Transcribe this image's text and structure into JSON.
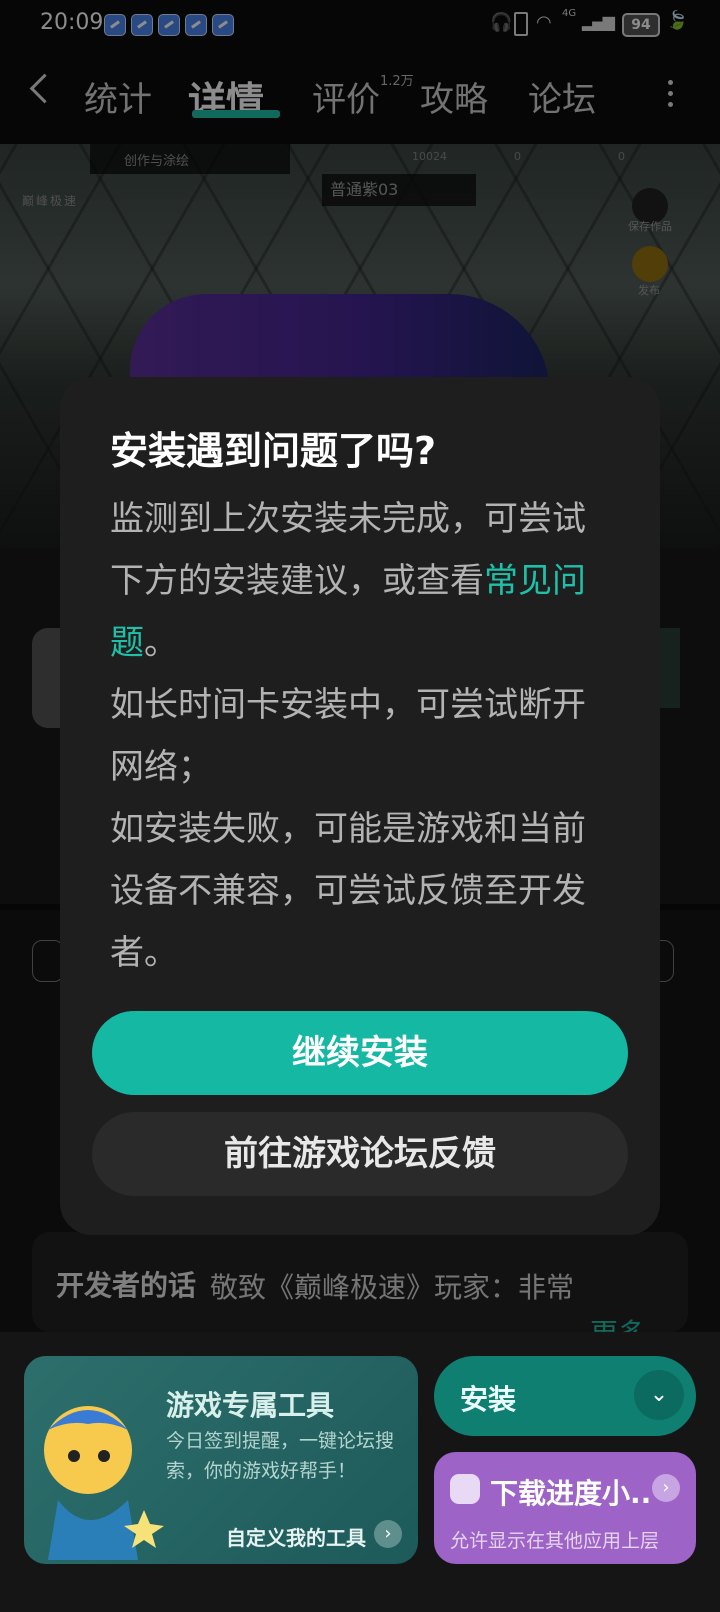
{
  "status_bar": {
    "time": "20:09",
    "network": "4G",
    "battery": "94"
  },
  "nav": {
    "tabs": [
      {
        "label": "统计"
      },
      {
        "label": "详情"
      },
      {
        "label": "评价"
      },
      {
        "label": "攻略"
      },
      {
        "label": "论坛"
      }
    ],
    "active_tab": "详情",
    "review_count_badge": "1.2万"
  },
  "hero": {
    "mode_label": "创作与涂绘",
    "coins": "10024",
    "gems": "0",
    "diamonds": "0",
    "paint_name": "普通紫03",
    "save_label": "保存作品",
    "publish_label": "发布"
  },
  "dialog": {
    "title": "安装遇到问题了吗?",
    "line1_prefix": "监测到上次安装未完成，可尝试下方的安装建议，或查看",
    "line1_link": "常见问题",
    "line1_suffix": "。",
    "line2": "如长时间卡安装中，可尝试断开网络；",
    "line3": "如安装失败，可能是游戏和当前设备不兼容，可尝试反馈至开发者。",
    "primary_button": "继续安装",
    "secondary_button": "前往游戏论坛反馈"
  },
  "background": {
    "dev_title": "开发者的话",
    "dev_body": "敬致《巅峰极速》玩家：非常",
    "dev_more": "更多"
  },
  "bottom": {
    "tool_title": "游戏专属工具",
    "tool_desc": "今日签到提醒，一键论坛搜索，你的游戏好帮手！",
    "tool_link": "自定义我的工具",
    "install_label": "安装",
    "progress_title": "下载进度小...",
    "progress_desc": "允许显示在其他应用上层"
  },
  "colors": {
    "accent": "#14b8a3",
    "link": "#1fc0a9",
    "progress_card": "#9d63c7"
  }
}
